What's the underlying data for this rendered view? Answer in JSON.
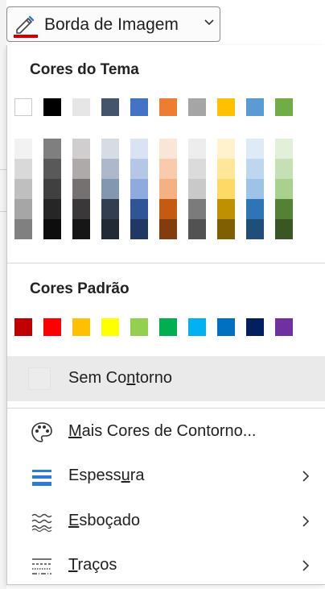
{
  "toolbar": {
    "label": "Borda de Imagem",
    "icon": "pencil-outline-icon",
    "accent_color": "#d00000"
  },
  "theme": {
    "title": "Cores do Tema",
    "base_colors": [
      "#ffffff",
      "#000000",
      "#e7e6e6",
      "#44546a",
      "#4472c4",
      "#ed7d31",
      "#a5a5a5",
      "#ffc000",
      "#5b9bd5",
      "#70ad47"
    ],
    "shade_columns": [
      [
        "#f2f2f2",
        "#d9d9d9",
        "#bfbfbf",
        "#a6a6a6",
        "#808080"
      ],
      [
        "#7f7f7f",
        "#595959",
        "#404040",
        "#262626",
        "#0d0d0d"
      ],
      [
        "#d0cece",
        "#aeaaaa",
        "#757171",
        "#3a3838",
        "#171616"
      ],
      [
        "#d6dce4",
        "#adb9ca",
        "#8497b0",
        "#333f4f",
        "#222a35"
      ],
      [
        "#dae3f3",
        "#b4c7e7",
        "#8faadc",
        "#2f5597",
        "#203864"
      ],
      [
        "#fbe5d6",
        "#f8cbad",
        "#f4b183",
        "#c55a11",
        "#843c0c"
      ],
      [
        "#ededed",
        "#dbdbdb",
        "#c9c9c9",
        "#7b7b7b",
        "#525252"
      ],
      [
        "#fff2cc",
        "#ffe699",
        "#ffd966",
        "#bf9000",
        "#7f6000"
      ],
      [
        "#deebf7",
        "#bdd7ee",
        "#9dc3e6",
        "#2e75b6",
        "#1f4e79"
      ],
      [
        "#e2f0d9",
        "#c5e0b4",
        "#a9d18e",
        "#548235",
        "#385723"
      ]
    ]
  },
  "standard": {
    "title": "Cores Padrão",
    "colors": [
      "#c00000",
      "#ff0000",
      "#ffc000",
      "#ffff00",
      "#92d050",
      "#00b050",
      "#00b0f0",
      "#0070c0",
      "#002060",
      "#7030a0"
    ]
  },
  "menu": {
    "no_outline": {
      "pre": "Sem Co",
      "key": "n",
      "post": "torno"
    },
    "more_colors": {
      "pre": "",
      "key": "M",
      "post": "ais Cores de Contorno...",
      "icon": "palette-icon"
    },
    "weight": {
      "pre": "Espess",
      "key": "u",
      "post": "ra",
      "icon": "line-weight-icon"
    },
    "sketched": {
      "pre": "",
      "key": "E",
      "post": "sboçado",
      "icon": "sketched-line-icon"
    },
    "dashes": {
      "pre": "",
      "key": "T",
      "post": "raços",
      "icon": "dashes-icon"
    }
  }
}
